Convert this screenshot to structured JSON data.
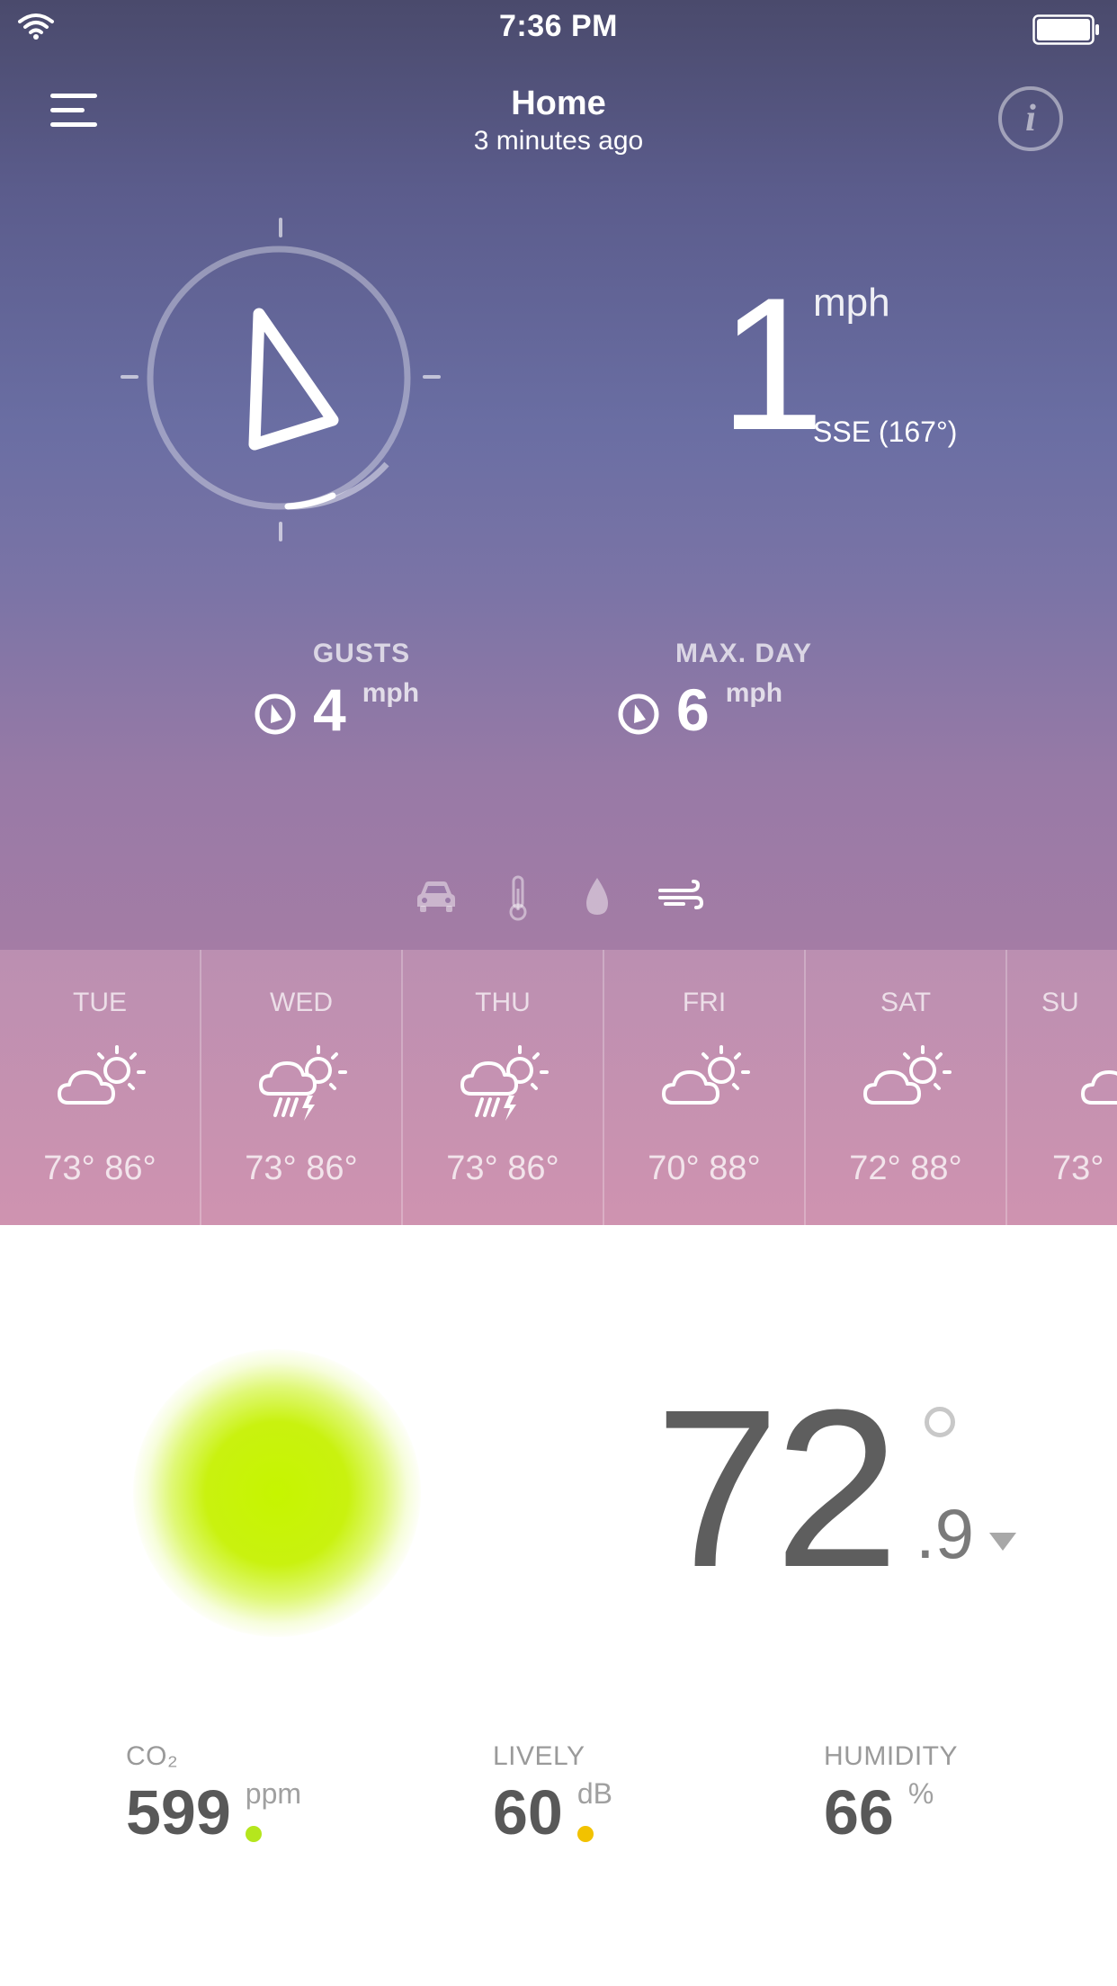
{
  "status_bar": {
    "time": "7:36 PM"
  },
  "header": {
    "title": "Home",
    "subtitle": "3 minutes ago",
    "info_label": "i"
  },
  "wind": {
    "speed": "1",
    "unit": "mph",
    "direction_text": "SSE (167°)",
    "direction_degrees": 167
  },
  "stats": {
    "gusts": {
      "label": "GUSTS",
      "value": "4",
      "unit": "mph"
    },
    "max_day": {
      "label": "MAX. DAY",
      "value": "6",
      "unit": "mph"
    }
  },
  "mode_icons": [
    "car-icon",
    "thermometer-icon",
    "droplet-icon",
    "wind-icon"
  ],
  "selected_mode": "wind-icon",
  "forecast": [
    {
      "day": "TUE",
      "icon": "partly-cloudy",
      "temps": "73° 86°"
    },
    {
      "day": "WED",
      "icon": "thunderstorm",
      "temps": "73° 86°"
    },
    {
      "day": "THU",
      "icon": "thunderstorm",
      "temps": "73° 86°"
    },
    {
      "day": "FRI",
      "icon": "partly-cloudy",
      "temps": "70° 88°"
    },
    {
      "day": "SAT",
      "icon": "partly-cloudy",
      "temps": "72° 88°"
    },
    {
      "day": "SU",
      "icon": "partly-cloudy",
      "temps": "73°"
    }
  ],
  "indoor": {
    "temperature_whole": "72",
    "temperature_fraction": ".9",
    "status_color": "#c6f500",
    "trend": "down"
  },
  "metrics": {
    "co2": {
      "label": "CO₂",
      "value": "599",
      "unit": "ppm",
      "dot_color": "#b5e61d"
    },
    "noise": {
      "label": "LIVELY",
      "value": "60",
      "unit": "dB",
      "dot_color": "#f2c200"
    },
    "humidity": {
      "label": "HUMIDITY",
      "value": "66",
      "unit": "%"
    }
  }
}
